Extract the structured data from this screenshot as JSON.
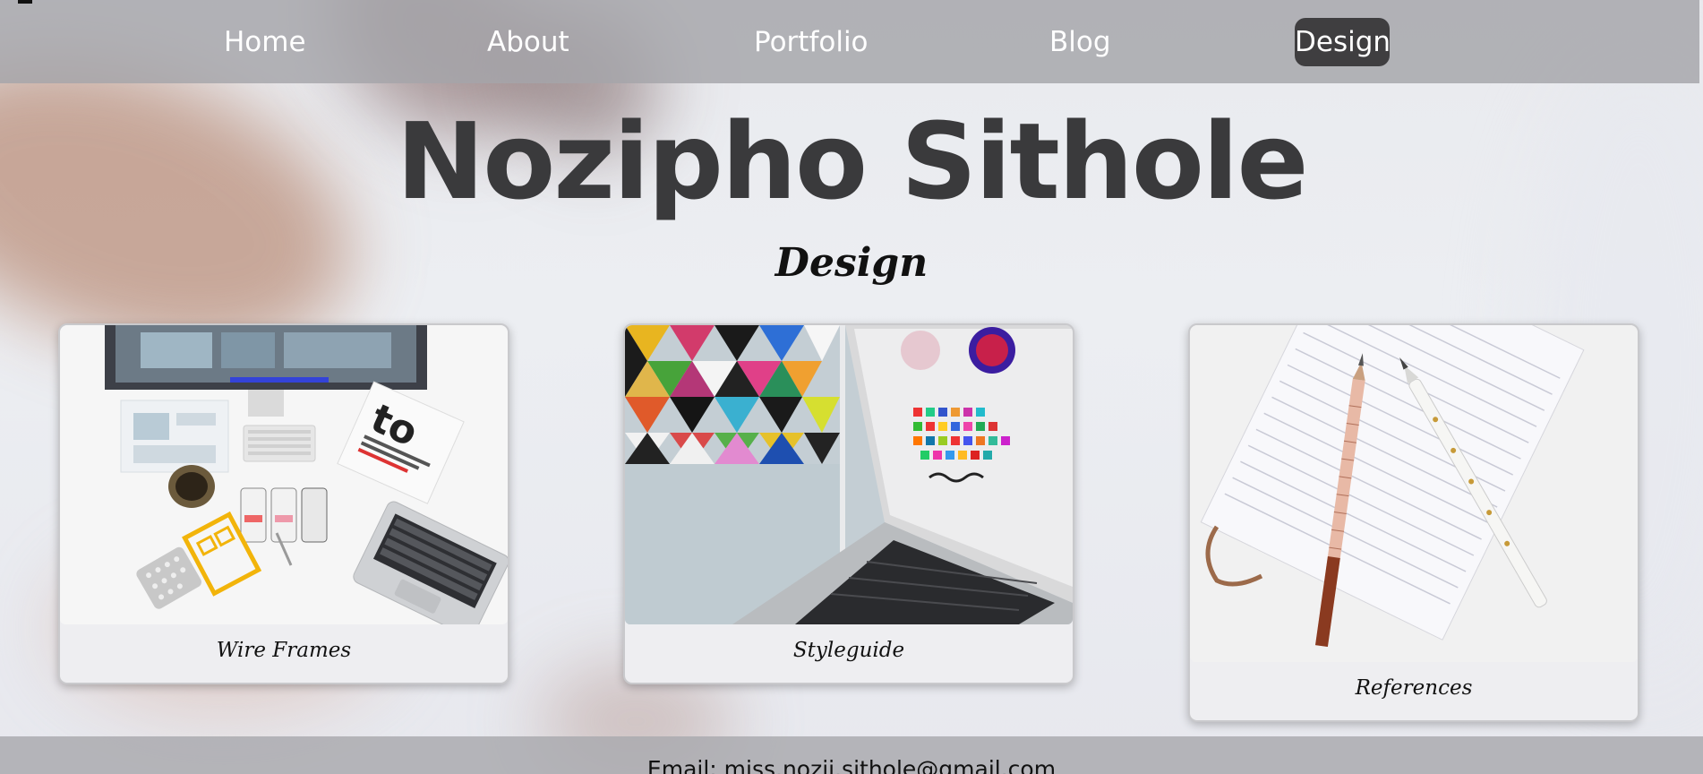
{
  "nav": {
    "items": [
      {
        "label": "Home"
      },
      {
        "label": "About"
      },
      {
        "label": "Portfolio"
      },
      {
        "label": "Blog"
      },
      {
        "label": "Design",
        "active": true
      }
    ],
    "active_bg": "#3f3e40"
  },
  "header": {
    "title": "Nozipho Sithole",
    "subtitle": "Design"
  },
  "cards": [
    {
      "caption": "Wire Frames",
      "image": "desk-wireframes-photo"
    },
    {
      "caption": "Styleguide",
      "image": "laptop-colorful-photo"
    },
    {
      "caption": "References",
      "image": "notebook-pens-photo"
    }
  ],
  "footer": {
    "email": "Email: miss.nozii.sithole@gmail.com"
  },
  "colors": {
    "title": "#3a3a3c",
    "navbar": "#a5a5aa",
    "text": "#111111"
  }
}
